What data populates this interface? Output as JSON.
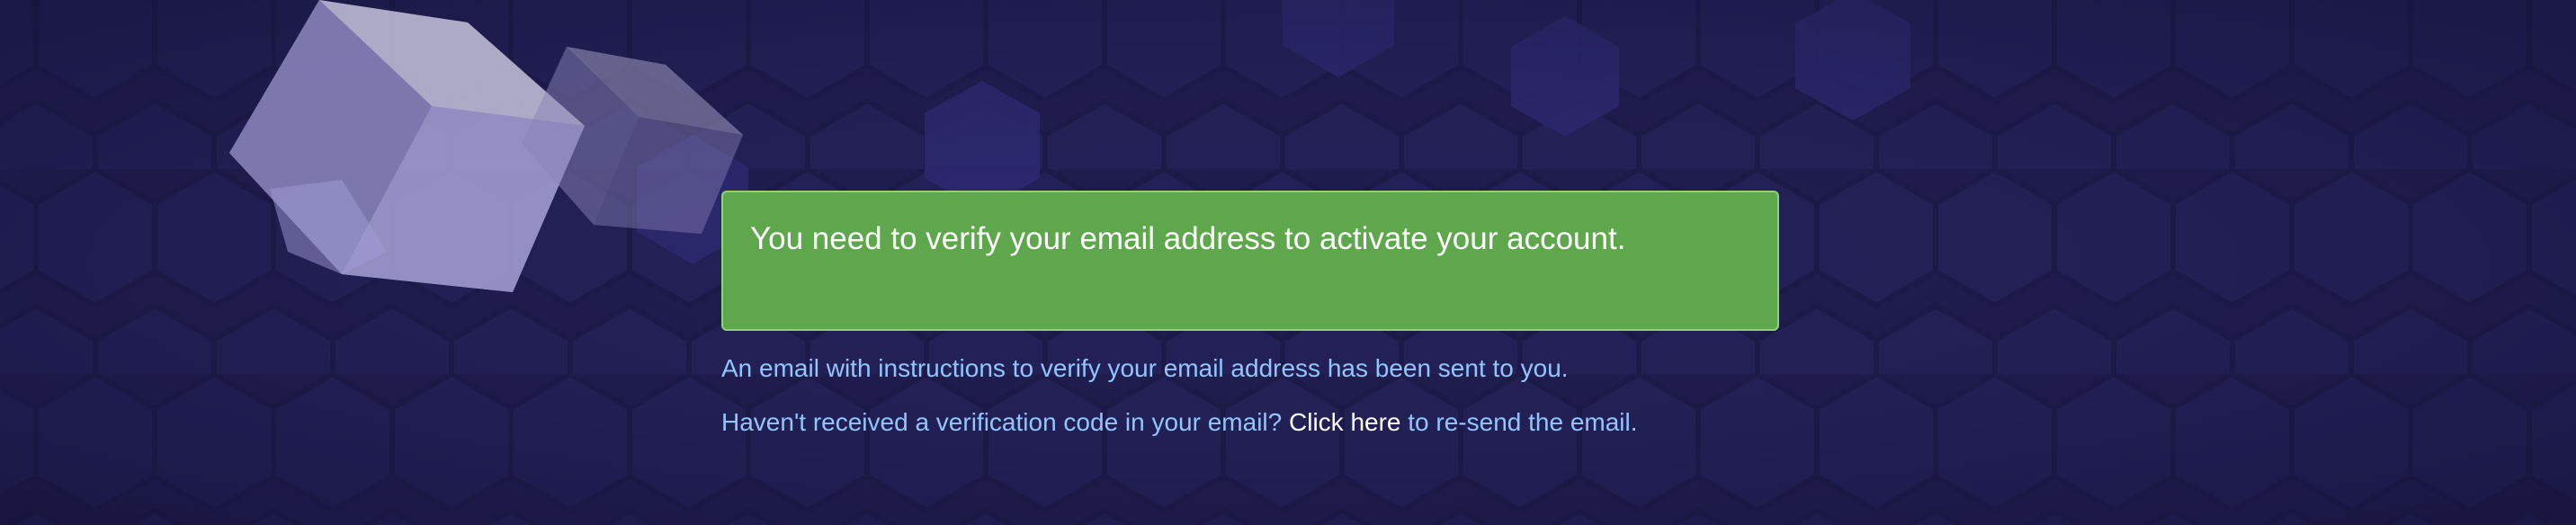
{
  "alert": {
    "message": "You need to verify your email address to activate your account."
  },
  "info": {
    "sent_message": "An email with instructions to verify your email address has been sent to you.",
    "resend_prefix": "Haven't received a verification code in your email?",
    "resend_link": "Click here",
    "resend_suffix": "to re-send the email."
  },
  "colors": {
    "background": "#1e1b4b",
    "alert_bg": "#5fa74c",
    "info_text": "#93c5fd",
    "link_text": "#ffffff"
  },
  "icons": [
    "cube-icon"
  ]
}
